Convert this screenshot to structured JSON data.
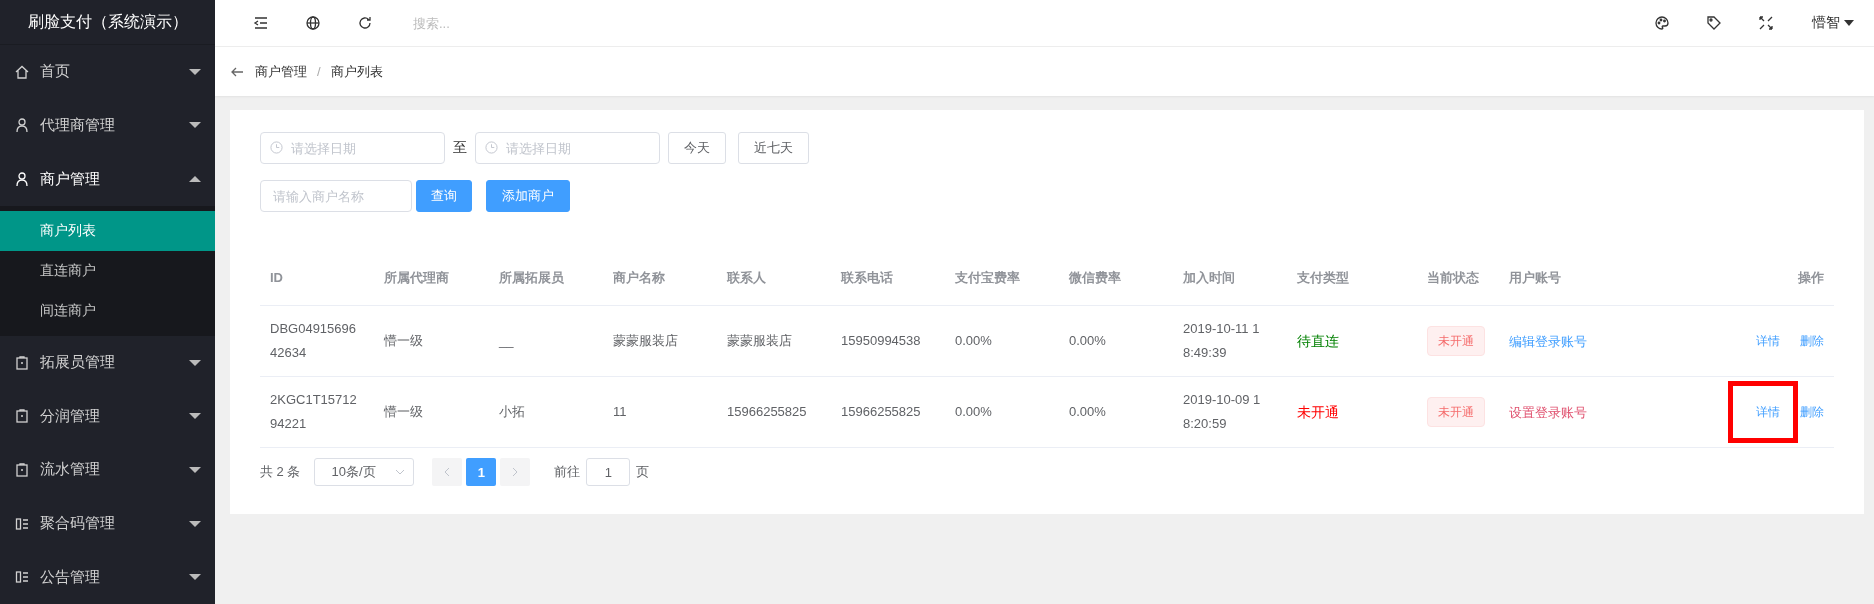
{
  "sidebar": {
    "title": "刷脸支付（系统演示）",
    "items": [
      {
        "label": "首页",
        "kind": "home",
        "expanded": false
      },
      {
        "label": "代理商管理",
        "kind": "user",
        "expanded": false
      },
      {
        "label": "商户管理",
        "kind": "user",
        "expanded": true,
        "children": [
          {
            "label": "商户列表",
            "selected": true
          },
          {
            "label": "直连商户",
            "selected": false
          },
          {
            "label": "间连商户",
            "selected": false
          }
        ]
      },
      {
        "label": "拓展员管理",
        "kind": "clipboard",
        "expanded": false
      },
      {
        "label": "分润管理",
        "kind": "clipboard",
        "expanded": false
      },
      {
        "label": "流水管理",
        "kind": "clipboard",
        "expanded": false
      },
      {
        "label": "聚合码管理",
        "kind": "grid",
        "expanded": false
      },
      {
        "label": "公告管理",
        "kind": "grid",
        "expanded": false
      }
    ]
  },
  "topbar": {
    "search_placeholder": "搜索...",
    "user": "懵智"
  },
  "breadcrumb": {
    "items": [
      "商户管理",
      "商户列表"
    ],
    "separator": "/"
  },
  "filters": {
    "start_placeholder": "请选择日期",
    "separator": "至",
    "end_placeholder": "请选择日期",
    "quick": [
      "今天",
      "近七天"
    ],
    "name_placeholder": "请输入商户名称",
    "query": "查询",
    "add": "添加商户"
  },
  "table": {
    "columns": [
      "ID",
      "所属代理商",
      "所属拓展员",
      "商户名称",
      "联系人",
      "联系电话",
      "支付宝费率",
      "微信费率",
      "加入时间",
      "支付类型",
      "当前状态",
      "用户账号",
      "操作"
    ],
    "rows": [
      {
        "id": "DBG04915696\n42634",
        "agent": "懵一级",
        "promoter": "__",
        "name": "蒙蒙服装店",
        "contact": "蒙蒙服装店",
        "phone": "15950994538",
        "alipay": "0.00%",
        "wechat": "0.00%",
        "time": "2019-10-11 1\n8:49:39",
        "pay_type": {
          "text": "待直连",
          "color": "#008000"
        },
        "status": "未开通",
        "account": {
          "text": "编辑登录账号",
          "color": "#409eff"
        },
        "actions": [
          {
            "label": "详情",
            "highlighted": false
          },
          {
            "label": "删除",
            "highlighted": false
          }
        ]
      },
      {
        "id": "2KGC1T15712\n94221",
        "agent": "懵一级",
        "promoter": "小拓",
        "name": "11",
        "contact": "15966255825",
        "phone": "15966255825",
        "alipay": "0.00%",
        "wechat": "0.00%",
        "time": "2019-10-09 1\n8:20:59",
        "pay_type": {
          "text": "未开通",
          "color": "#ff0000"
        },
        "status": "未开通",
        "account": {
          "text": "设置登录账号",
          "color": "#e0506e"
        },
        "actions": [
          {
            "label": "详情",
            "highlighted": true
          },
          {
            "label": "删除",
            "highlighted": false
          }
        ]
      }
    ]
  },
  "pagination": {
    "total": "共 2 条",
    "page_size": "10条/页",
    "pages": [
      {
        "label": "1",
        "selected": true
      }
    ],
    "goto_label": "前往",
    "goto_value": "1",
    "goto_suffix": "页"
  }
}
